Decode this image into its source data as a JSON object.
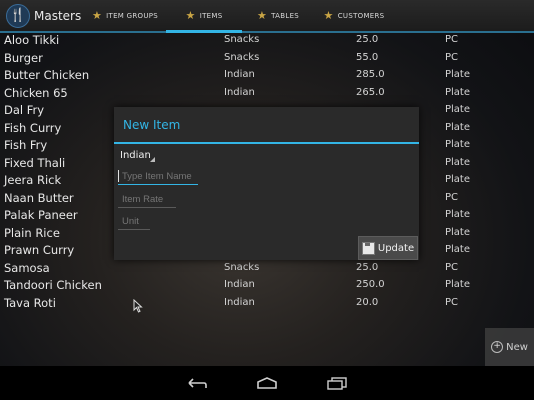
{
  "app": {
    "title": "Masters",
    "logo_icon": "cutlery-icon"
  },
  "tabs": [
    {
      "label": "ITEM GROUPS",
      "selected": false
    },
    {
      "label": "ITEMS",
      "selected": true
    },
    {
      "label": "TABLES",
      "selected": false
    },
    {
      "label": "CUSTOMERS",
      "selected": false
    }
  ],
  "items": [
    {
      "name": "Aloo Tikki",
      "category": "Snacks",
      "rate": "25.0",
      "unit": "PC"
    },
    {
      "name": "Burger",
      "category": "Snacks",
      "rate": "55.0",
      "unit": "PC"
    },
    {
      "name": "Butter Chicken",
      "category": "Indian",
      "rate": "285.0",
      "unit": "Plate"
    },
    {
      "name": "Chicken 65",
      "category": "Indian",
      "rate": "265.0",
      "unit": "Plate"
    },
    {
      "name": "Dal Fry",
      "category": "",
      "rate": "",
      "unit": "Plate"
    },
    {
      "name": "Fish Curry",
      "category": "",
      "rate": "",
      "unit": "Plate"
    },
    {
      "name": "Fish Fry",
      "category": "",
      "rate": "",
      "unit": "Plate"
    },
    {
      "name": "Fixed Thali",
      "category": "",
      "rate": "",
      "unit": "Plate"
    },
    {
      "name": "Jeera Rick",
      "category": "",
      "rate": "",
      "unit": "Plate"
    },
    {
      "name": "Naan Butter",
      "category": "",
      "rate": "",
      "unit": "PC"
    },
    {
      "name": "Palak Paneer",
      "category": "",
      "rate": "",
      "unit": "Plate"
    },
    {
      "name": "Plain Rice",
      "category": "",
      "rate": "",
      "unit": "Plate"
    },
    {
      "name": "Prawn Curry",
      "category": "",
      "rate": "",
      "unit": "Plate"
    },
    {
      "name": "Samosa",
      "category": "Snacks",
      "rate": "25.0",
      "unit": "PC"
    },
    {
      "name": "Tandoori Chicken",
      "category": "Indian",
      "rate": "250.0",
      "unit": "Plate"
    },
    {
      "name": "Tava Roti",
      "category": "Indian",
      "rate": "20.0",
      "unit": "PC"
    }
  ],
  "dialog": {
    "title": "New Item",
    "group_selected": "Indian",
    "name_placeholder": "Type Item Name",
    "rate_placeholder": "Item Rate",
    "unit_placeholder": "Unit",
    "update_label": "Update"
  },
  "new_button_label": "New",
  "colors": {
    "accent": "#33b5e5",
    "star": "#c9a545"
  }
}
